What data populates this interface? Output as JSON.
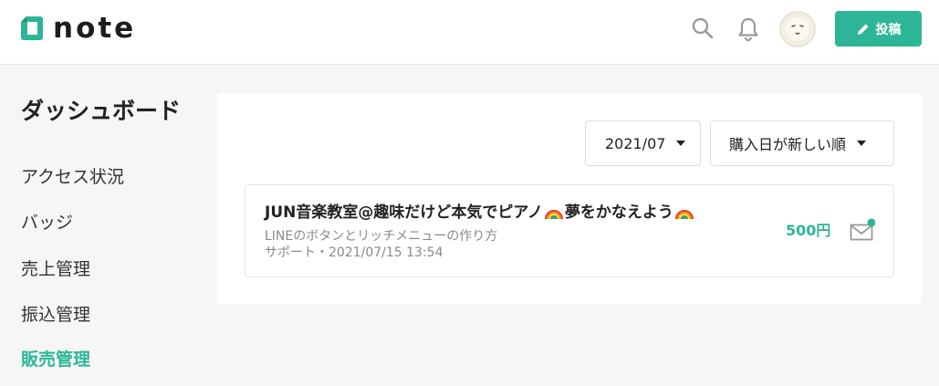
{
  "header": {
    "logo_text": "note",
    "post_button_label": "投稿",
    "icons": [
      "note-logo-icon",
      "search-icon",
      "bell-icon",
      "avatar",
      "pencil-icon"
    ]
  },
  "sidebar": {
    "title": "ダッシュボード",
    "items": [
      {
        "label": "アクセス状況",
        "active": false
      },
      {
        "label": "バッジ",
        "active": false
      },
      {
        "label": "売上管理",
        "active": false
      },
      {
        "label": "振込管理",
        "active": false
      },
      {
        "label": "販売管理",
        "active": true
      }
    ]
  },
  "filters": {
    "month": "2021/07",
    "sort": "購入日が新しい順"
  },
  "sales": [
    {
      "title_part1": "JUN音楽教室@趣味だけど本気でピアノ",
      "title_part2": "夢をかなえよう",
      "item_name": "LINEのボタンとリッチメニューの作り方",
      "meta": "サポート・2021/07/15 13:54",
      "price": "500円",
      "unread": true
    }
  ],
  "colors": {
    "accent": "#2cb696",
    "background": "#f5f6f5",
    "text": "#222222",
    "subtext": "#8a8a8a"
  }
}
